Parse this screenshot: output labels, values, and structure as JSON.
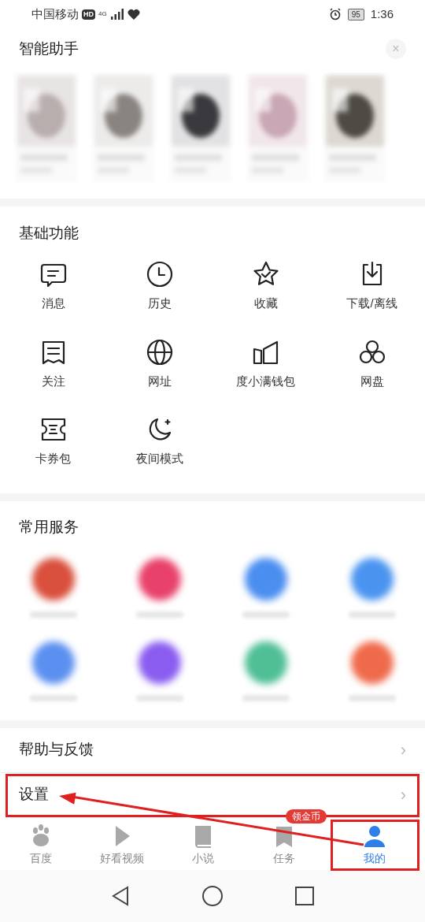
{
  "status_bar": {
    "carrier": "中国移动",
    "hd": "HD",
    "network": "4G",
    "battery": "95",
    "time": "1:36"
  },
  "assistant": {
    "title": "智能助手",
    "close": "×"
  },
  "basic": {
    "title": "基础功能",
    "items": [
      {
        "label": "消息",
        "kind": "message"
      },
      {
        "label": "历史",
        "kind": "clock"
      },
      {
        "label": "收藏",
        "kind": "star"
      },
      {
        "label": "下载/离线",
        "kind": "download"
      },
      {
        "label": "关注",
        "kind": "follow"
      },
      {
        "label": "网址",
        "kind": "globe"
      },
      {
        "label": "度小满钱包",
        "kind": "wallet"
      },
      {
        "label": "网盘",
        "kind": "cloud"
      },
      {
        "label": "卡券包",
        "kind": "ticket"
      },
      {
        "label": "夜间模式",
        "kind": "moon"
      }
    ]
  },
  "services": {
    "title": "常用服务",
    "items": [
      {
        "color": "#d9503c"
      },
      {
        "color": "#e8416a"
      },
      {
        "color": "#4a8ef0"
      },
      {
        "color": "#4a94f0"
      },
      {
        "color": "#5b90f0"
      },
      {
        "color": "#8a5cf0"
      },
      {
        "color": "#4fbf95"
      },
      {
        "color": "#ef6a4a"
      }
    ]
  },
  "menu": [
    {
      "label": "帮助与反馈",
      "chevron": "›",
      "highlighted": false
    },
    {
      "label": "设置",
      "chevron": "›",
      "highlighted": true
    }
  ],
  "tab_bar": [
    {
      "label": "百度",
      "kind": "paw",
      "selected": false
    },
    {
      "label": "好看视频",
      "kind": "play",
      "selected": false
    },
    {
      "label": "小说",
      "kind": "book",
      "selected": false
    },
    {
      "label": "任务",
      "kind": "task",
      "selected": false,
      "badge": "领金币"
    },
    {
      "label": "我的",
      "kind": "person",
      "selected": true
    }
  ]
}
